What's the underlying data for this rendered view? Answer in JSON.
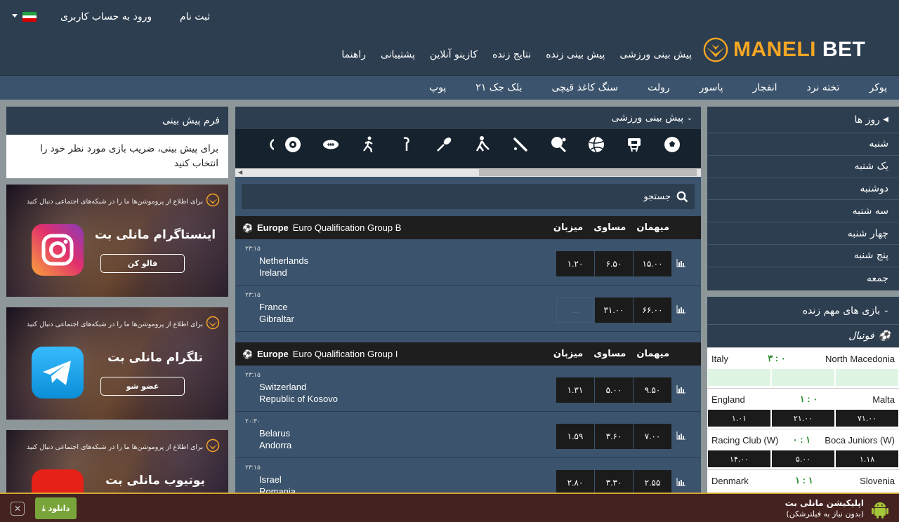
{
  "header": {
    "brand_part1": "MANELI",
    "brand_part2": "BET",
    "signup": "ثبت نام",
    "login": "ورود به حساب کاربری",
    "main_nav": [
      "پیش بینی ورزشی",
      "پیش بینی زنده",
      "نتایج زنده",
      "کازینو آنلاین",
      "پشتیبانی",
      "راهنما"
    ],
    "sub_nav": [
      "پوکر",
      "تخته نرد",
      "انفجار",
      "پاسور",
      "رولت",
      "سنگ کاغذ قیچی",
      "بلک جک ۲۱",
      "پوپ"
    ]
  },
  "days": {
    "title": "روز ها",
    "items": [
      "شنبه",
      "یک شنبه",
      "دوشنبه",
      "سه شنبه",
      "چهار شنبه",
      "پنج شنبه",
      "جمعه"
    ]
  },
  "live": {
    "title": "بازی های مهم زنده",
    "sport": "فوتبال",
    "matches": [
      {
        "home": "North Macedonia",
        "away": "Italy",
        "score": "۳ : ۰",
        "odds": []
      },
      {
        "home": "Malta",
        "away": "England",
        "score": "۱ : ۰",
        "odds": [
          "۷۱.۰۰",
          "۲۱.۰۰",
          "۱.۰۱"
        ]
      },
      {
        "home": "Boca Juniors (W)",
        "away": "Racing Club (W)",
        "score": "۰ : ۱",
        "odds": [
          "۱.۱۸",
          "۵.۰۰",
          "۱۴.۰۰"
        ]
      },
      {
        "home": "Slovenia",
        "away": "Denmark",
        "score": "۱ : ۱",
        "odds": []
      }
    ]
  },
  "center": {
    "title": "پیش بینی ورزشی",
    "search_placeholder": "جستجو",
    "col_home": "میهمان",
    "col_draw": "مساوی",
    "col_away": "میزبان",
    "groups": [
      {
        "region": "Europe",
        "league": "Euro Qualification Group B",
        "matches": [
          {
            "time": "۲۳:۱۵",
            "t1": "Netherlands",
            "t2": "Ireland",
            "odds": [
              "۱۵.۰۰",
              "۶.۵۰",
              "۱.۲۰"
            ]
          },
          {
            "time": "۲۳:۱۵",
            "t1": "France",
            "t2": "Gibraltar",
            "odds": [
              "۶۶.۰۰",
              "۳۱.۰۰",
              "..."
            ]
          }
        ]
      },
      {
        "region": "Europe",
        "league": "Euro Qualification Group I",
        "matches": [
          {
            "time": "۲۳:۱۵",
            "t1": "Switzerland",
            "t2": "Republic of Kosovo",
            "odds": [
              "۹.۵۰",
              "۵.۰۰",
              "۱.۳۱"
            ]
          },
          {
            "time": "۲۰:۳۰",
            "t1": "Belarus",
            "t2": "Andorra",
            "odds": [
              "۷.۰۰",
              "۳.۶۰",
              "۱.۵۹"
            ]
          },
          {
            "time": "۲۳:۱۵",
            "t1": "Israel",
            "t2": "Romania",
            "odds": [
              "۲.۵۵",
              "۳.۳۰",
              "۲.۸۰"
            ]
          }
        ]
      }
    ]
  },
  "form": {
    "title": "فرم پیش بینی",
    "body": "برای پیش بینی، ضریب بازی مورد نظر خود را انتخاب کنید"
  },
  "banners": [
    {
      "note": "برای اطلاع از پروموشن‌ها ما را در شبکه‌های اجتماعی دنبال کنید",
      "title": "اینستاگرام مانلی بت",
      "button": "فالو کن"
    },
    {
      "note": "برای اطلاع از پروموشن‌ها ما را در شبکه‌های اجتماعی دنبال کنید",
      "title": "تلگرام مانلی بت",
      "button": "عضو شو"
    },
    {
      "note": "برای اطلاع از پروموشن‌ها ما را در شبکه‌های اجتماعی دنبال کنید",
      "title": "یوتیوب مانلی بت",
      "button": ""
    }
  ],
  "appbar": {
    "title": "اپلیکیشن مانلی بت",
    "subtitle": "(بدون نیاز به فیلترشکن)",
    "download": "دانلود"
  },
  "colors": {
    "accent": "#f5a623",
    "header": "#2d3e50",
    "subnav": "#3b536c",
    "download": "#79a43a"
  }
}
